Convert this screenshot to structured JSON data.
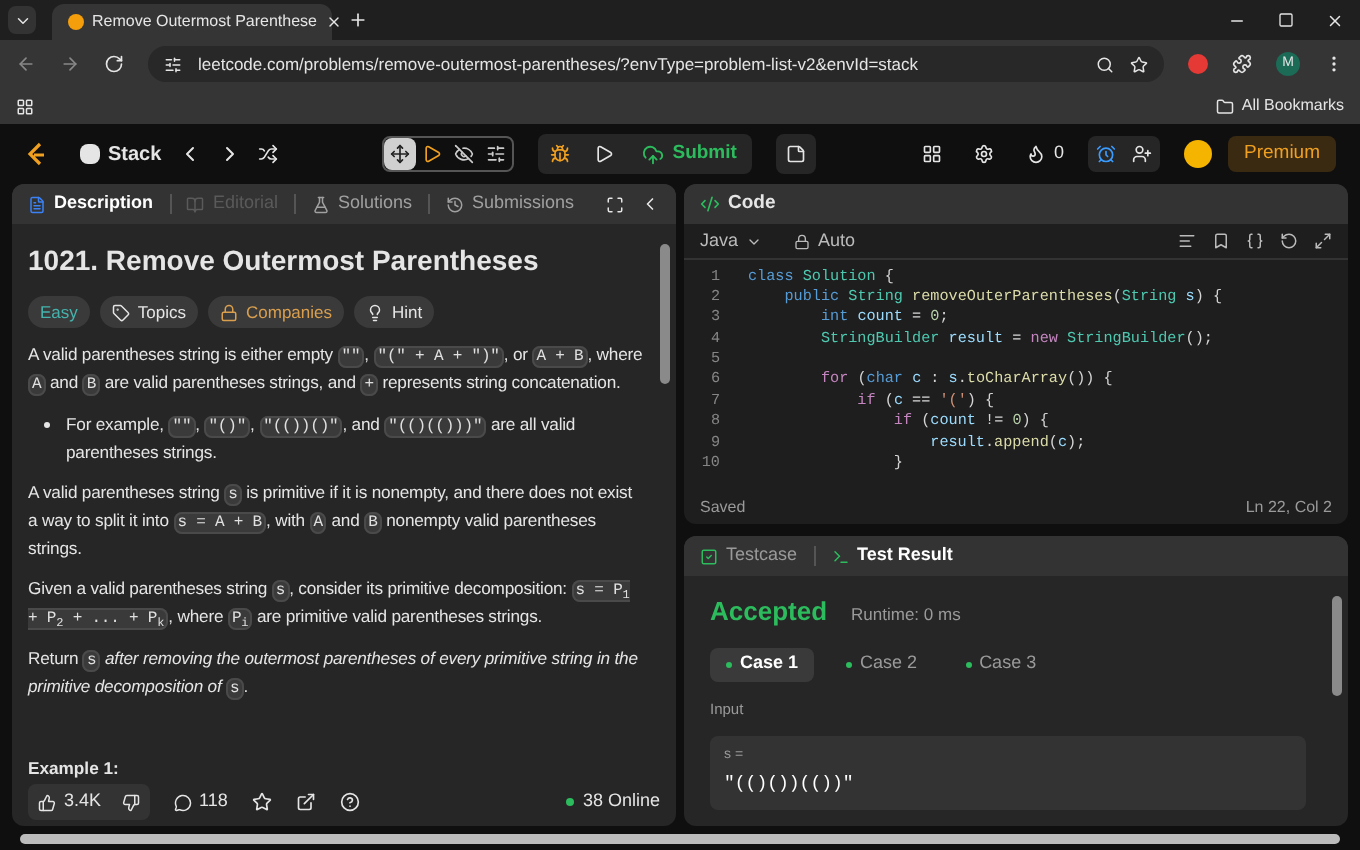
{
  "browser": {
    "tab_title": "Remove Outermost Parenthese",
    "url": "leetcode.com/problems/remove-outermost-parentheses/?envType=problem-list-v2&envId=stack",
    "profile": "M",
    "bookmarks_label": "All Bookmarks"
  },
  "nav": {
    "problem_list": "Stack",
    "submit": "Submit",
    "streak": "0",
    "premium": "Premium",
    "layout_tools": [
      {
        "selected": true
      },
      {
        "selected": false
      },
      {
        "selected": false
      },
      {
        "selected": false
      }
    ]
  },
  "description_panel": {
    "tabs": [
      {
        "label": "Description",
        "selected": true,
        "disabled": false
      },
      {
        "label": "Editorial",
        "selected": false,
        "disabled": true
      },
      {
        "label": "Solutions",
        "selected": false,
        "disabled": false
      },
      {
        "label": "Submissions",
        "selected": false,
        "disabled": false
      }
    ],
    "title": "1021. Remove Outermost Parentheses",
    "tags": [
      {
        "kind": "difficulty",
        "label": "Easy"
      },
      {
        "kind": "topics",
        "label": "Topics"
      },
      {
        "kind": "companies",
        "label": "Companies"
      },
      {
        "kind": "hint",
        "label": "Hint"
      }
    ],
    "blocks": [
      {
        "kind": "paragraph",
        "segments": [
          {
            "kind": "text",
            "text": "A valid parentheses string is either empty "
          },
          {
            "kind": "code",
            "text": "\"\""
          },
          {
            "kind": "text",
            "text": ", "
          },
          {
            "kind": "code",
            "text": "\"(\" + A + \")\""
          },
          {
            "kind": "text",
            "text": ", or "
          },
          {
            "kind": "code",
            "text": "A + B"
          },
          {
            "kind": "text",
            "text": ", where "
          },
          {
            "kind": "code",
            "text": "A"
          },
          {
            "kind": "text",
            "text": " and "
          },
          {
            "kind": "code",
            "text": "B"
          },
          {
            "kind": "text",
            "text": " are valid parentheses strings, and "
          },
          {
            "kind": "code",
            "text": "+"
          },
          {
            "kind": "text",
            "text": " represents string concatenation."
          }
        ]
      },
      {
        "kind": "bullet",
        "segments": [
          {
            "kind": "text",
            "text": "For example, "
          },
          {
            "kind": "code",
            "text": "\"\""
          },
          {
            "kind": "text",
            "text": ", "
          },
          {
            "kind": "code",
            "text": "\"()\""
          },
          {
            "kind": "text",
            "text": ", "
          },
          {
            "kind": "code",
            "text": "\"(())()\""
          },
          {
            "kind": "text",
            "text": ", and "
          },
          {
            "kind": "code",
            "text": "\"(()(()))\""
          },
          {
            "kind": "text",
            "text": " are all valid parentheses strings."
          }
        ]
      },
      {
        "kind": "paragraph",
        "segments": [
          {
            "kind": "text",
            "text": "A valid parentheses string "
          },
          {
            "kind": "code",
            "text": "s"
          },
          {
            "kind": "text",
            "text": " is primitive if it is nonempty, and there does not exist a way to split it into "
          },
          {
            "kind": "code",
            "text": "s = A + B"
          },
          {
            "kind": "text",
            "text": ", with "
          },
          {
            "kind": "code",
            "text": "A"
          },
          {
            "kind": "text",
            "text": " and "
          },
          {
            "kind": "code",
            "text": "B"
          },
          {
            "kind": "text",
            "text": " nonempty valid parentheses strings."
          }
        ]
      },
      {
        "kind": "paragraph",
        "segments": [
          {
            "kind": "text",
            "text": "Given a valid parentheses string "
          },
          {
            "kind": "code",
            "text": "s"
          },
          {
            "kind": "text",
            "text": ", consider its primitive decomposition: "
          },
          {
            "kind": "code",
            "text": "s = P$_{1}$ + P$_{2}$ + ... + P$_{k}$"
          },
          {
            "kind": "text",
            "text": ", where "
          },
          {
            "kind": "code",
            "text": "P$_{i}$"
          },
          {
            "kind": "text",
            "text": " are primitive valid parentheses strings."
          }
        ]
      },
      {
        "kind": "paragraph",
        "segments": [
          {
            "kind": "text",
            "text": "Return "
          },
          {
            "kind": "code",
            "text": "s"
          },
          {
            "kind": "italic",
            "text": " after removing the outermost parentheses of every primitive string in the primitive decomposition of "
          },
          {
            "kind": "code",
            "text": "s"
          },
          {
            "kind": "text",
            "text": "."
          }
        ]
      },
      {
        "kind": "heading",
        "segments": [
          {
            "kind": "text",
            "text": "Example 1:"
          }
        ]
      }
    ],
    "footer": {
      "likes": "3.4K",
      "comments": "118",
      "online": "38 Online"
    }
  },
  "code_panel": {
    "title": "Code",
    "language": "Java",
    "mode": "Auto",
    "status": "Saved",
    "cursor": "Ln 22, Col 2",
    "lines": [
      {
        "number": "1",
        "tokens": [
          {
            "kind": "keyword",
            "text": "class "
          },
          {
            "kind": "type",
            "text": "Solution"
          },
          {
            "kind": "plain",
            "text": " {"
          }
        ]
      },
      {
        "number": "2",
        "tokens": [
          {
            "kind": "keyword",
            "text": "    public "
          },
          {
            "kind": "type",
            "text": "String "
          },
          {
            "kind": "function",
            "text": "removeOuterParentheses"
          },
          {
            "kind": "plain",
            "text": "("
          },
          {
            "kind": "type",
            "text": "String "
          },
          {
            "kind": "variable",
            "text": "s"
          },
          {
            "kind": "plain",
            "text": ") {"
          }
        ]
      },
      {
        "number": "3",
        "tokens": [
          {
            "kind": "keyword",
            "text": "        int "
          },
          {
            "kind": "variable",
            "text": "count"
          },
          {
            "kind": "plain",
            "text": " = "
          },
          {
            "kind": "number",
            "text": "0"
          },
          {
            "kind": "plain",
            "text": ";"
          }
        ]
      },
      {
        "number": "4",
        "tokens": [
          {
            "kind": "type",
            "text": "        StringBuilder "
          },
          {
            "kind": "variable",
            "text": "result"
          },
          {
            "kind": "plain",
            "text": " = "
          },
          {
            "kind": "control",
            "text": "new "
          },
          {
            "kind": "type",
            "text": "StringBuilder"
          },
          {
            "kind": "plain",
            "text": "();"
          }
        ]
      },
      {
        "number": "5"
      },
      {
        "number": "6",
        "tokens": [
          {
            "kind": "control",
            "text": "        for"
          },
          {
            "kind": "plain",
            "text": " ("
          },
          {
            "kind": "keyword",
            "text": "char "
          },
          {
            "kind": "variable",
            "text": "c"
          },
          {
            "kind": "plain",
            "text": " : "
          },
          {
            "kind": "variable",
            "text": "s"
          },
          {
            "kind": "plain",
            "text": "."
          },
          {
            "kind": "function",
            "text": "toCharArray"
          },
          {
            "kind": "plain",
            "text": "()) {"
          }
        ]
      },
      {
        "number": "7",
        "tokens": [
          {
            "kind": "control",
            "text": "            if"
          },
          {
            "kind": "plain",
            "text": " ("
          },
          {
            "kind": "variable",
            "text": "c"
          },
          {
            "kind": "plain",
            "text": " == "
          },
          {
            "kind": "string",
            "text": "'('"
          },
          {
            "kind": "plain",
            "text": ") {"
          }
        ]
      },
      {
        "number": "8",
        "tokens": [
          {
            "kind": "control",
            "text": "                if"
          },
          {
            "kind": "plain",
            "text": " ("
          },
          {
            "kind": "variable",
            "text": "count"
          },
          {
            "kind": "plain",
            "text": " != "
          },
          {
            "kind": "number",
            "text": "0"
          },
          {
            "kind": "plain",
            "text": ") {"
          }
        ]
      },
      {
        "number": "9",
        "tokens": [
          {
            "kind": "variable",
            "text": "                    result"
          },
          {
            "kind": "plain",
            "text": "."
          },
          {
            "kind": "function",
            "text": "append"
          },
          {
            "kind": "plain",
            "text": "("
          },
          {
            "kind": "variable",
            "text": "c"
          },
          {
            "kind": "plain",
            "text": ");"
          }
        ]
      },
      {
        "number": "10",
        "tokens": [
          {
            "kind": "plain",
            "text": "                }"
          }
        ]
      }
    ]
  },
  "result_panel": {
    "tabs": [
      {
        "label": "Testcase",
        "selected": false
      },
      {
        "label": "Test Result",
        "selected": true
      }
    ],
    "verdict": "Accepted",
    "runtime": "Runtime: 0 ms",
    "cases": [
      {
        "label": "Case 1",
        "selected": true
      },
      {
        "label": "Case 2",
        "selected": false
      },
      {
        "label": "Case 3",
        "selected": false
      }
    ],
    "input_label": "Input",
    "input_name": "s =",
    "input_value": "\"(()())(())\""
  }
}
